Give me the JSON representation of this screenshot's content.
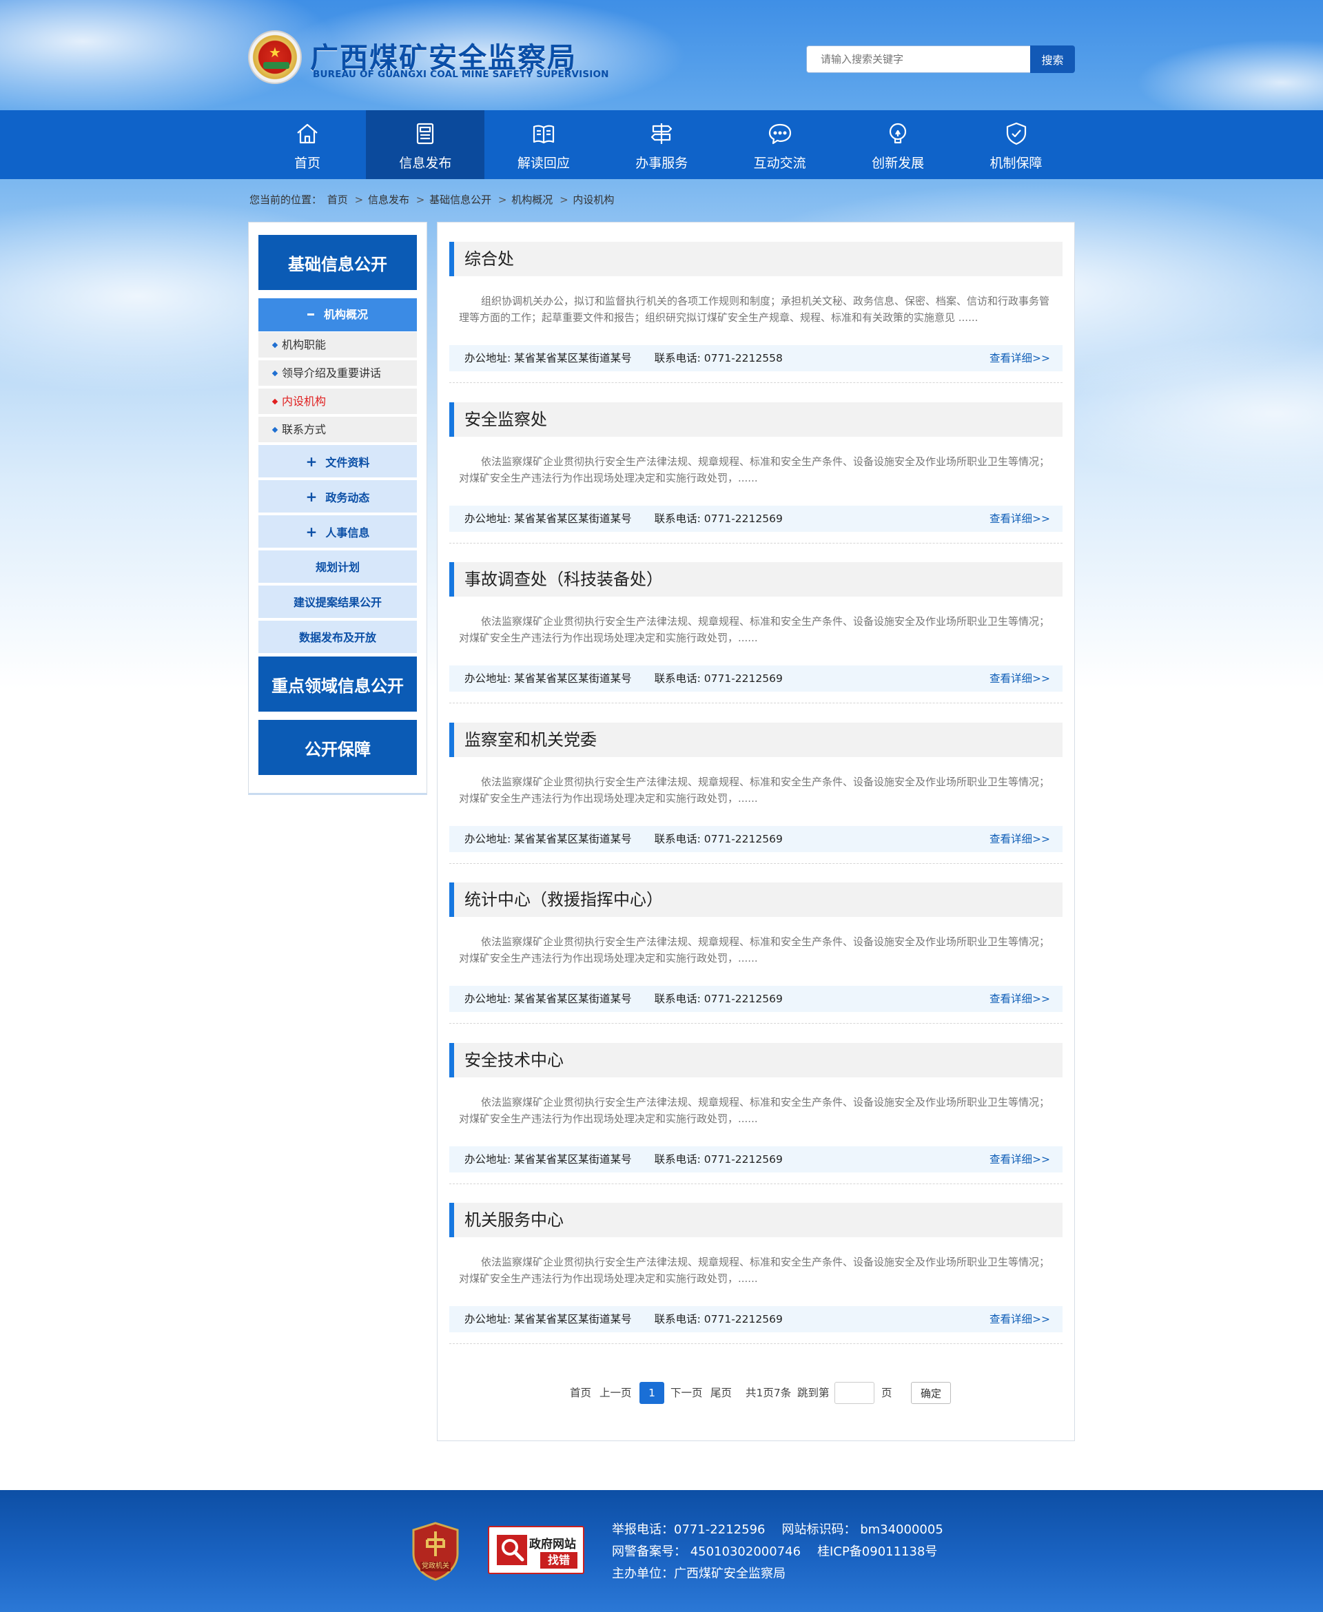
{
  "header": {
    "logo_cn": "广西煤矿安全监察局",
    "logo_en": "BUREAU OF GUANGXI COAL MINE SAFETY SUPERVISION",
    "search_placeholder": "请输入搜索关键字",
    "search_button": "搜索"
  },
  "nav": [
    {
      "label": "首页",
      "icon": "home-icon",
      "active": false
    },
    {
      "label": "信息发布",
      "icon": "newspaper-icon",
      "active": true
    },
    {
      "label": "解读回应",
      "icon": "book-icon",
      "active": false
    },
    {
      "label": "办事服务",
      "icon": "signpost-icon",
      "active": false
    },
    {
      "label": "互动交流",
      "icon": "chat-icon",
      "active": false
    },
    {
      "label": "创新发展",
      "icon": "lightbulb-icon",
      "active": false
    },
    {
      "label": "机制保障",
      "icon": "shield-check-icon",
      "active": false
    }
  ],
  "breadcrumb": {
    "prefix": "您当前的位置：",
    "items": [
      "首页",
      "信息发布",
      "基础信息公开",
      "机构概况",
      "内设机构"
    ],
    "separator": ">"
  },
  "sidebar": {
    "section1": "基础信息公开",
    "active_sub": "机构概况",
    "leaves": [
      "机构职能",
      "领导介绍及重要讲话",
      "内设机构",
      "联系方式"
    ],
    "current_leaf_index": 2,
    "subs_expandable": [
      "文件资料",
      "政务动态",
      "人事信息"
    ],
    "subs_plain": [
      "规划计划",
      "建议提案结果公开",
      "数据发布及开放"
    ],
    "section2": "重点领域信息公开",
    "section3": "公开保障"
  },
  "entries": [
    {
      "title": "综合处",
      "desc": "组织协调机关办公，拟订和监督执行机关的各项工作规则和制度；承担机关文秘、政务信息、保密、档案、信访和行政事务管理等方面的工作；起草重要文件和报告；组织研究拟订煤矿安全生产规章、规程、标准和有关政策的实施意见 ......",
      "address": "办公地址: 某省某省某区某街道某号",
      "phone": "联系电话: 0771-2212558",
      "more": "查看详细>>"
    },
    {
      "title": "安全监察处",
      "desc": "依法监察煤矿企业贯彻执行安全生产法律法规、规章规程、标准和安全生产条件、设备设施安全及作业场所职业卫生等情况；对煤矿安全生产违法行为作出现场处理决定和实施行政处罚，......",
      "address": "办公地址: 某省某省某区某街道某号",
      "phone": "联系电话: 0771-2212569",
      "more": "查看详细>>"
    },
    {
      "title": "事故调查处（科技装备处）",
      "desc": "依法监察煤矿企业贯彻执行安全生产法律法规、规章规程、标准和安全生产条件、设备设施安全及作业场所职业卫生等情况；对煤矿安全生产违法行为作出现场处理决定和实施行政处罚，......",
      "address": "办公地址: 某省某省某区某街道某号",
      "phone": "联系电话: 0771-2212569",
      "more": "查看详细>>"
    },
    {
      "title": "监察室和机关党委",
      "desc": "依法监察煤矿企业贯彻执行安全生产法律法规、规章规程、标准和安全生产条件、设备设施安全及作业场所职业卫生等情况；对煤矿安全生产违法行为作出现场处理决定和实施行政处罚，......",
      "address": "办公地址: 某省某省某区某街道某号",
      "phone": "联系电话: 0771-2212569",
      "more": "查看详细>>"
    },
    {
      "title": "统计中心（救援指挥中心）",
      "desc": "依法监察煤矿企业贯彻执行安全生产法律法规、规章规程、标准和安全生产条件、设备设施安全及作业场所职业卫生等情况；对煤矿安全生产违法行为作出现场处理决定和实施行政处罚，......",
      "address": "办公地址: 某省某省某区某街道某号",
      "phone": "联系电话: 0771-2212569",
      "more": "查看详细>>"
    },
    {
      "title": "安全技术中心",
      "desc": "依法监察煤矿企业贯彻执行安全生产法律法规、规章规程、标准和安全生产条件、设备设施安全及作业场所职业卫生等情况；对煤矿安全生产违法行为作出现场处理决定和实施行政处罚，......",
      "address": "办公地址: 某省某省某区某街道某号",
      "phone": "联系电话: 0771-2212569",
      "more": "查看详细>>"
    },
    {
      "title": "机关服务中心",
      "desc": "依法监察煤矿企业贯彻执行安全生产法律法规、规章规程、标准和安全生产条件、设备设施安全及作业场所职业卫生等情况；对煤矿安全生产违法行为作出现场处理决定和实施行政处罚，......",
      "address": "办公地址: 某省某省某区某街道某号",
      "phone": "联系电话: 0771-2212569",
      "more": "查看详细>>"
    }
  ],
  "pager": {
    "first": "首页",
    "prev": "上一页",
    "current": "1",
    "next": "下一页",
    "last": "尾页",
    "summary": "共1页7条",
    "jump_label": "跳到第",
    "page_unit": "页",
    "confirm": "确定"
  },
  "footer": {
    "badge_text": "党政机关",
    "gov_line1": "政府网站",
    "gov_line2": "找错",
    "line1a": "举报电话：0771-2212596",
    "line1b": "网站标识码： bm34000005",
    "line2a": "网警备案号： 45010302000746",
    "line2b": "桂ICP备09011138号",
    "line3": "主办单位：广西煤矿安全监察局"
  },
  "colors": {
    "nav_bg": "#0f63c9",
    "nav_active": "#0b4a9c",
    "sidebar_head": "#0b5bb5",
    "accent": "#1677e0",
    "current_leaf": "#e02020",
    "footer": "#1a63c2"
  }
}
